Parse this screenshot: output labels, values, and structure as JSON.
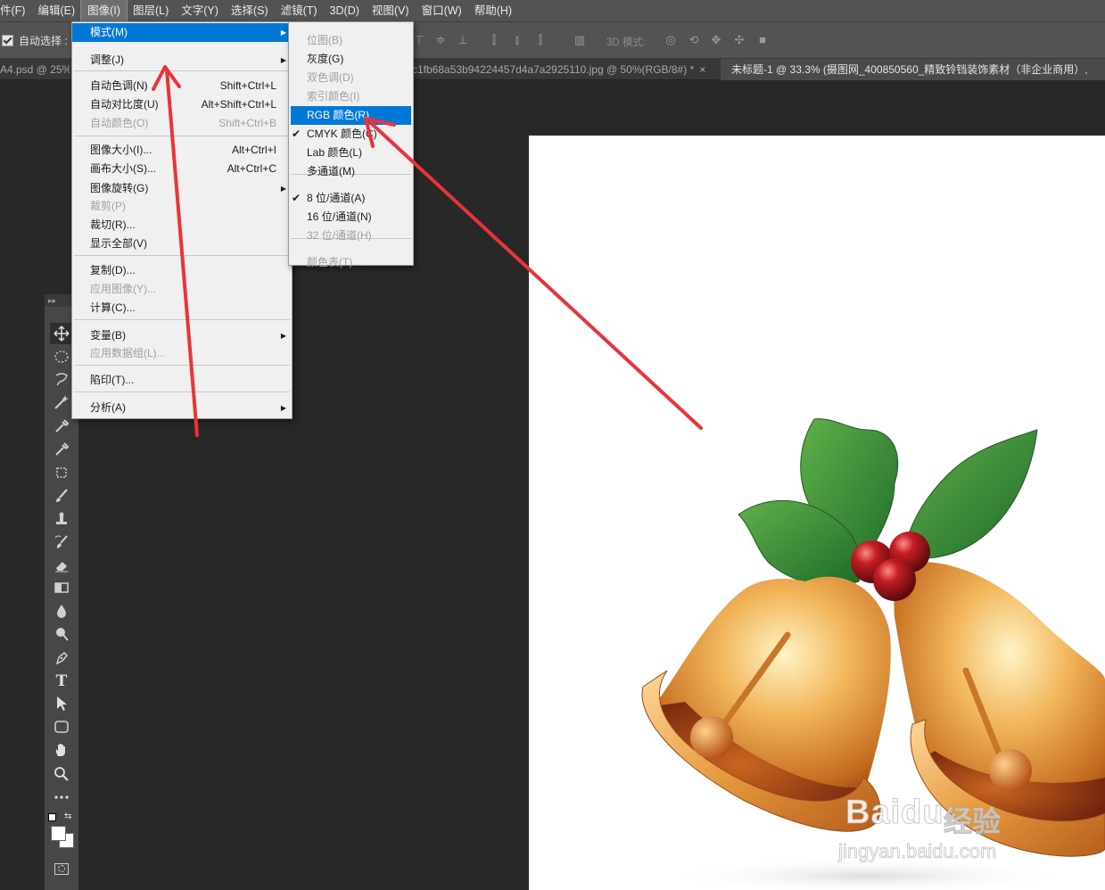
{
  "menubar": {
    "items": [
      "件(F)",
      "编辑(E)",
      "图像(I)",
      "图层(L)",
      "文字(Y)",
      "选择(S)",
      "滤镜(T)",
      "3D(D)",
      "视图(V)",
      "窗口(W)",
      "帮助(H)"
    ],
    "active_index": 2
  },
  "options": {
    "auto_select_label": "自动选择 :",
    "mode_3d_label": "3D 模式:"
  },
  "tabs": [
    {
      "label": "A4.psd @ 25%(",
      "close": ""
    },
    {
      "label": "c1fb68a53b94224457d4a7a2925110.jpg @ 50%(RGB/8#) *",
      "close": "×"
    },
    {
      "label": "未标题-1 @ 33.3% (摄图网_400850560_精致铃铛装饰素材（非企业商用）,",
      "close": ""
    }
  ],
  "image_menu": {
    "items": [
      {
        "label": "模式(M)",
        "shortcut": "",
        "submenu": true,
        "highlighted": true,
        "disabled": false
      },
      {
        "label": "调整(J)",
        "shortcut": "",
        "submenu": true,
        "disabled": false
      },
      {
        "label": "自动色调(N)",
        "shortcut": "Shift+Ctrl+L",
        "disabled": false
      },
      {
        "label": "自动对比度(U)",
        "shortcut": "Alt+Shift+Ctrl+L",
        "disabled": false
      },
      {
        "label": "自动颜色(O)",
        "shortcut": "Shift+Ctrl+B",
        "disabled": true
      },
      {
        "label": "图像大小(I)...",
        "shortcut": "Alt+Ctrl+I",
        "disabled": false
      },
      {
        "label": "画布大小(S)...",
        "shortcut": "Alt+Ctrl+C",
        "disabled": false
      },
      {
        "label": "图像旋转(G)",
        "shortcut": "",
        "submenu": true,
        "disabled": false
      },
      {
        "label": "裁剪(P)",
        "shortcut": "",
        "disabled": true
      },
      {
        "label": "裁切(R)...",
        "shortcut": "",
        "disabled": false
      },
      {
        "label": "显示全部(V)",
        "shortcut": "",
        "disabled": false
      },
      {
        "label": "复制(D)...",
        "shortcut": "",
        "disabled": false
      },
      {
        "label": "应用图像(Y)...",
        "shortcut": "",
        "disabled": true
      },
      {
        "label": "计算(C)...",
        "shortcut": "",
        "disabled": false
      },
      {
        "label": "变量(B)",
        "shortcut": "",
        "submenu": true,
        "disabled": false
      },
      {
        "label": "应用数据组(L)...",
        "shortcut": "",
        "disabled": true
      },
      {
        "label": "陷印(T)...",
        "shortcut": "",
        "disabled": false
      },
      {
        "label": "分析(A)",
        "shortcut": "",
        "submenu": true,
        "disabled": false
      }
    ]
  },
  "mode_submenu": {
    "items": [
      {
        "label": "位图(B)",
        "disabled": true,
        "checked": false
      },
      {
        "label": "灰度(G)",
        "disabled": false,
        "checked": false
      },
      {
        "label": "双色调(D)",
        "disabled": true,
        "checked": false
      },
      {
        "label": "索引颜色(I)",
        "disabled": true,
        "checked": false
      },
      {
        "label": "RGB 颜色(R)",
        "disabled": false,
        "checked": false,
        "highlighted": true
      },
      {
        "label": "CMYK 颜色(C)",
        "disabled": false,
        "checked": true
      },
      {
        "label": "Lab 颜色(L)",
        "disabled": false,
        "checked": false
      },
      {
        "label": "多通道(M)",
        "disabled": false,
        "checked": false
      },
      {
        "label": "8 位/通道(A)",
        "disabled": false,
        "checked": true
      },
      {
        "label": "16 位/通道(N)",
        "disabled": false,
        "checked": false
      },
      {
        "label": "32 位/通道(H)",
        "disabled": true,
        "checked": false
      },
      {
        "label": "颜色表(T)...",
        "disabled": true,
        "checked": false
      }
    ]
  },
  "tools": [
    "move-tool-icon",
    "marquee-tool-icon",
    "lasso-tool-icon",
    "magic-wand-icon",
    "eyedropper-icon",
    "eyedropper-alt-icon",
    "crop-tool-icon",
    "brush-tool-icon",
    "stamp-tool-icon",
    "history-brush-icon",
    "eraser-tool-icon",
    "gradient-tool-icon",
    "blur-tool-icon",
    "dodge-tool-icon",
    "pen-tool-icon",
    "type-tool-icon",
    "path-select-icon",
    "shape-tool-icon",
    "hand-tool-icon",
    "zoom-tool-icon",
    "more-tools-icon"
  ],
  "toolbar_text": {
    "type_glyph": "T"
  },
  "watermark": {
    "brand": "Bai",
    "paw": "du",
    "product": "经验",
    "url": "jingyan.baidu.com"
  },
  "colors": {
    "highlight": "#0078d7",
    "arrow": "#e8343a",
    "menu_bg": "#f0f0f0",
    "ui_dark": "#282828"
  }
}
